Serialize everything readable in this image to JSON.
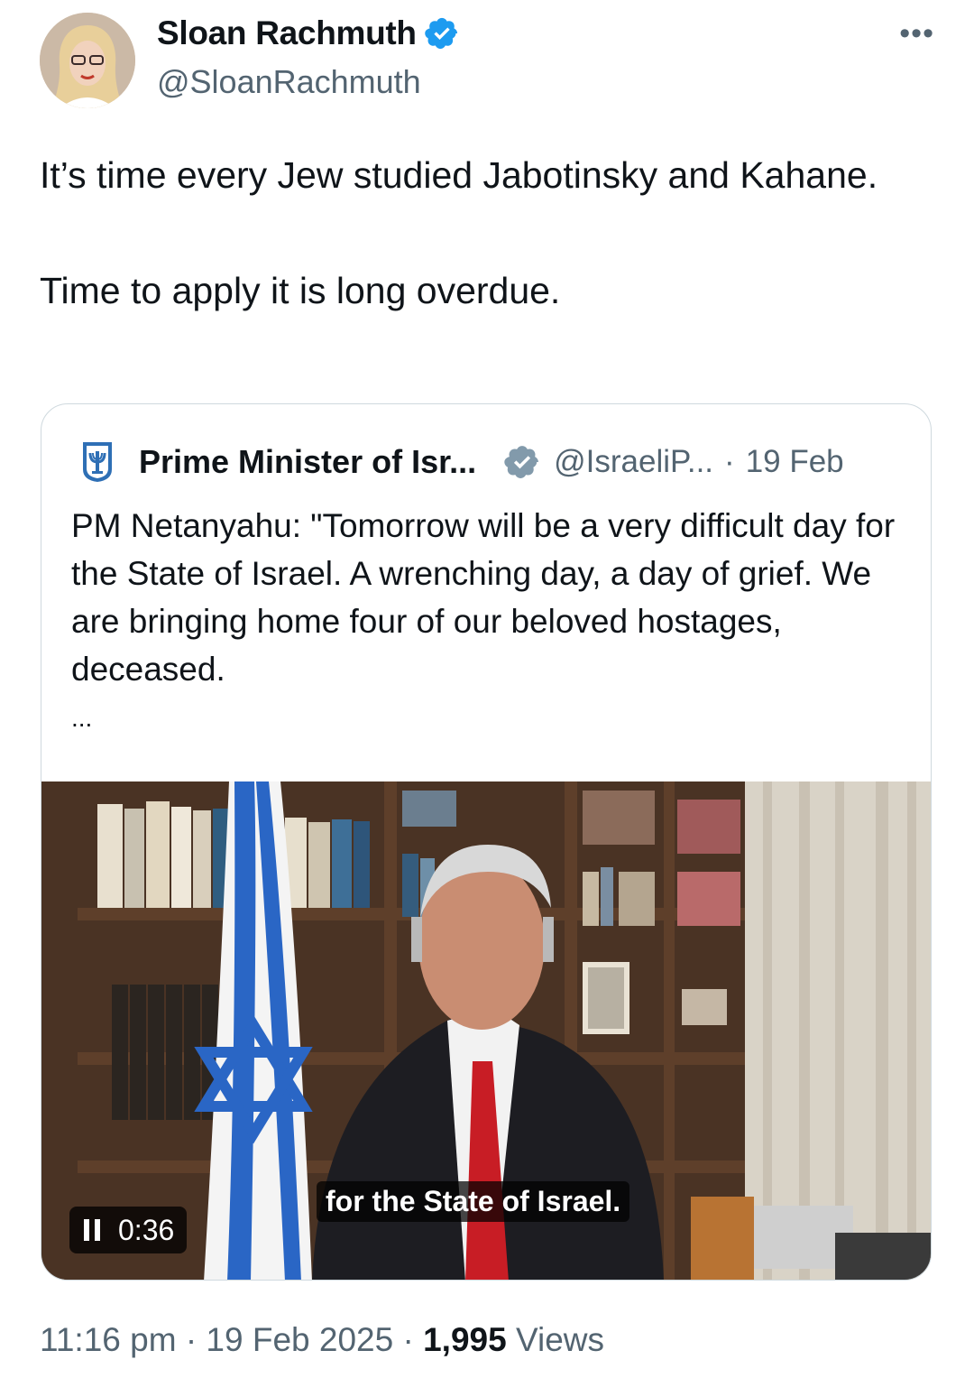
{
  "author": {
    "name": "Sloan Rachmuth",
    "handle": "@SloanRachmuth"
  },
  "more_label": "•••",
  "tweet": {
    "paragraph1": "It’s time every Jew studied Jabotinsky and Kahane.",
    "paragraph2": "Time to apply it is long overdue."
  },
  "quoted": {
    "name": "Prime Minister of Isr...",
    "handle": "@IsraeliP...",
    "separator": "·",
    "date": "19 Feb",
    "text": "PM Netanyahu: \"Tomorrow will be a very difficult day for the State of Israel. A wrenching day, a day of grief. We are bringing home four of our beloved hostages, deceased.",
    "ellipsis": "...",
    "video": {
      "caption": "for the State of Israel.",
      "time": "0:36"
    }
  },
  "meta": {
    "time": "11:16 pm",
    "sep1": "·",
    "date": "19 Feb 2025",
    "sep2": "·",
    "views_count": "1,995",
    "views_label": "Views"
  },
  "colors": {
    "verified_blue": "#1d9bf0",
    "gov_badge_gray": "#829aab",
    "secondary_text": "#536471"
  }
}
